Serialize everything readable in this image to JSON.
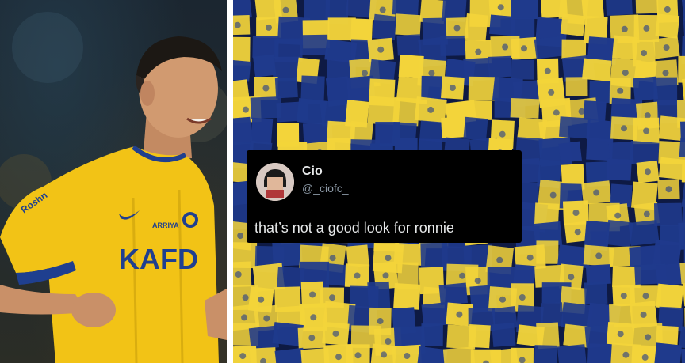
{
  "left_photo": {
    "subject": "footballer-celebrating",
    "jersey_color": "#f2c316",
    "trim_color": "#1f3f8f",
    "jersey_text_main": "KAFD",
    "jersey_text_sponsor": "ARRIYA",
    "sleeve_text": "Roshn"
  },
  "right_photo": {
    "subject": "fans-with-yellow-and-blue-flags",
    "colors": {
      "yellow": "#f3d43a",
      "blue": "#1f3a8c",
      "navy": "#0e1a44"
    }
  },
  "tweet": {
    "display_name": "Cio",
    "handle": "@_ciofc_",
    "text": "that’s not a good look for ronnie",
    "avatar_icon": "profile-avatar-icon"
  }
}
